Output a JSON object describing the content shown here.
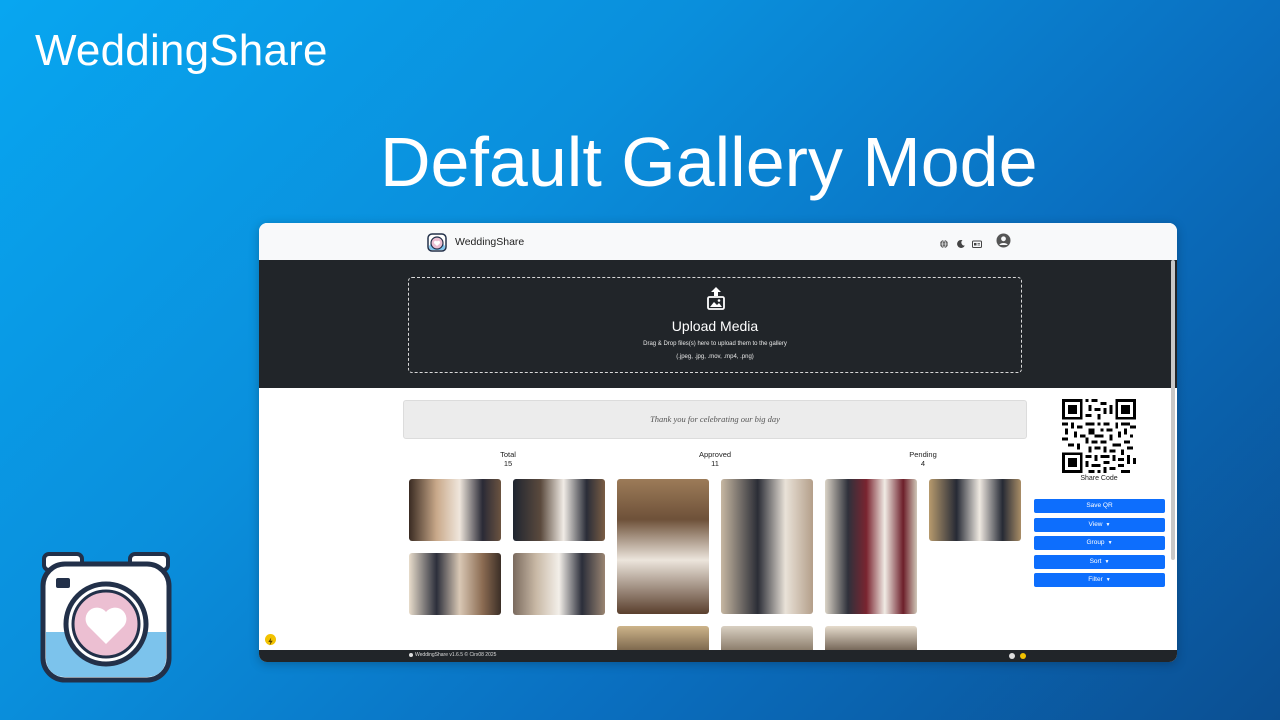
{
  "slide": {
    "brand": "WeddingShare",
    "title": "Default Gallery Mode"
  },
  "navbar": {
    "brand": "WeddingShare",
    "icons": [
      "language-icon",
      "dark-mode-icon",
      "id-card-icon",
      "account-icon"
    ]
  },
  "upload": {
    "title": "Upload Media",
    "subtitle": "Drag & Drop files(s) here to upload them to the gallery",
    "types": "(.jpeg, .jpg, .mov, .mp4, .png)"
  },
  "banner": {
    "message": "Thank you for celebrating our big day"
  },
  "stats": [
    {
      "label": "Total",
      "value": "15"
    },
    {
      "label": "Approved",
      "value": "11"
    },
    {
      "label": "Pending",
      "value": "4"
    }
  ],
  "sidebar": {
    "share_code_label": "Share Code",
    "buttons": {
      "save_qr": "Save QR",
      "view": "View",
      "group": "Group",
      "sort": "Sort",
      "filter": "Filter"
    }
  },
  "footer": {
    "text": "WeddingShare v1.6.5 © Cirx08 2025"
  },
  "colors": {
    "accent": "#0d6efd",
    "dark": "#212529",
    "background_start": "#08a6f0",
    "background_end": "#0b4f92"
  }
}
